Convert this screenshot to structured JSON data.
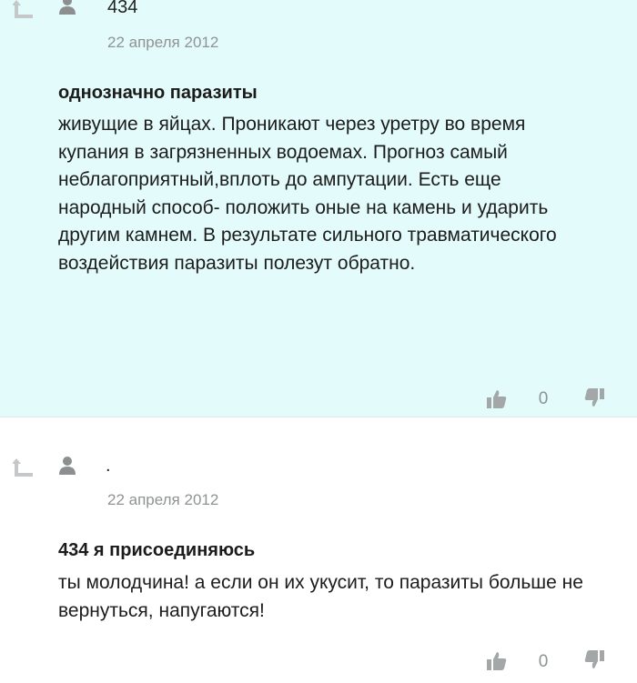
{
  "comments": [
    {
      "author": "434",
      "date": "22 апреля 2012",
      "title": "однозначно паразиты",
      "body": "живущие в яйцах. Проникают через уретру во время купания в загрязненных водоемах. Прогноз самый неблагоприятный,вплоть до ампутации. Есть еще народный способ- положить оные на камень и ударить другим камнем. В результате сильного травматического воздействия паразиты полезут обратно.",
      "score": "0",
      "background": "#e3fbfb"
    },
    {
      "author": ".",
      "date": "22 апреля 2012",
      "title": "434 я присоединяюсь",
      "body": "ты молодчина! а если он их укусит, то паразиты больше не вернуться, напугаются!",
      "score": "0",
      "background": "#ffffff"
    }
  ],
  "icons": {
    "reply": "reply-arrow-icon",
    "user": "user-silhouette-icon",
    "like": "thumbs-up-icon",
    "dislike": "thumbs-down-icon"
  },
  "colors": {
    "icon_gray": "#c4c8c8",
    "text": "#1c1c1c",
    "muted": "#8f9393"
  }
}
